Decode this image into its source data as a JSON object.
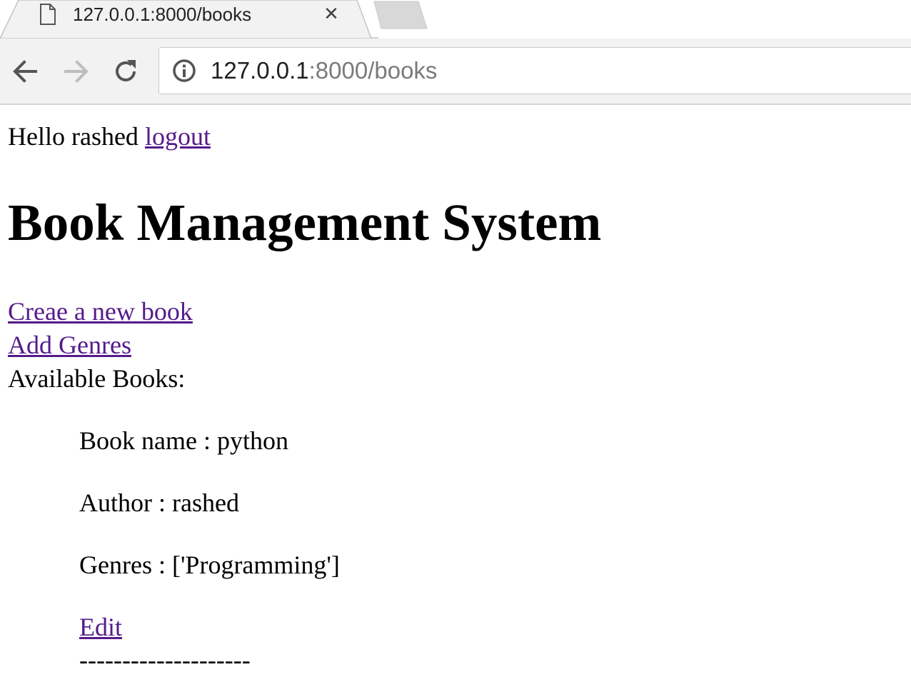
{
  "browser": {
    "tab": {
      "title": "127.0.0.1:8000/books",
      "close": "✕"
    },
    "url": {
      "host": "127.0.0.1",
      "rest": ":8000/books"
    },
    "icons": [
      "page-icon",
      "close-icon",
      "new-tab-icon",
      "back-icon",
      "forward-icon",
      "reload-icon",
      "info-icon"
    ]
  },
  "page": {
    "greeting": "Hello rashed",
    "logout": "logout",
    "heading": "Book Management System",
    "create_link": "Creae a new book",
    "genres_link": "Add Genres",
    "available": "Available Books:",
    "books": [
      {
        "name": "Book name : python",
        "author": "Author : rashed",
        "genres": "Genres : ['Programming']",
        "edit": "Edit",
        "separator": "--------------------"
      }
    ]
  },
  "colors": {
    "link": "#551a8b",
    "chrome": "#f2f2f2"
  }
}
